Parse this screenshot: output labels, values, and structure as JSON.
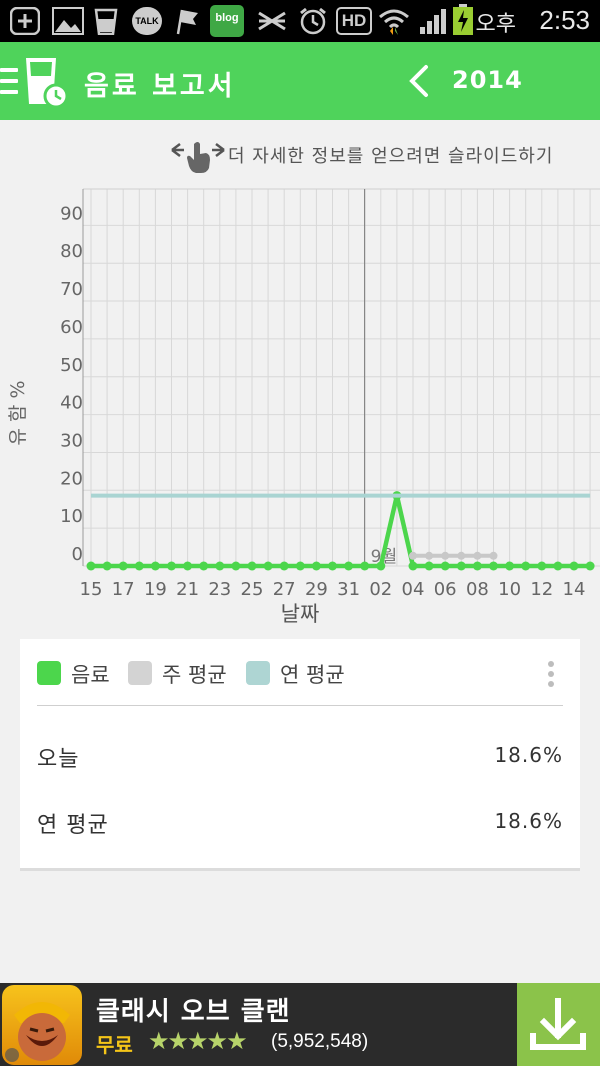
{
  "status_bar": {
    "icons": [
      "add-icon",
      "gallery-icon",
      "cup-icon",
      "kakaotalk-icon",
      "flag-icon",
      "blog-icon",
      "signal-off-icon",
      "alarm-icon",
      "hd-icon",
      "wifi-icon",
      "cell-signal-icon",
      "battery-charging-icon"
    ],
    "kakao_label": "TALK",
    "blog_label": "blog",
    "hd_label": "HD",
    "ampm": "오후",
    "time": "2:53"
  },
  "appbar": {
    "title": "음료 보고서",
    "year": "2014",
    "colors": {
      "primary": "#4fd35b"
    }
  },
  "hint": {
    "text": "더 자세한 정보를 얻으려면 슬라이드하기"
  },
  "chart_data": {
    "type": "line",
    "ylabel": "유 함 %",
    "xlabel": "날짜",
    "ylim": [
      0,
      100
    ],
    "yticks": [
      0,
      10,
      20,
      30,
      40,
      50,
      60,
      70,
      80,
      90
    ],
    "x_tick_labels": [
      "15",
      "17",
      "19",
      "21",
      "23",
      "25",
      "27",
      "29",
      "31",
      "02",
      "04",
      "06",
      "08",
      "10",
      "12",
      "14"
    ],
    "month_marker": "9월",
    "x": [
      "08-15",
      "08-16",
      "08-17",
      "08-18",
      "08-19",
      "08-20",
      "08-21",
      "08-22",
      "08-23",
      "08-24",
      "08-25",
      "08-26",
      "08-27",
      "08-28",
      "08-29",
      "08-30",
      "08-31",
      "09-01",
      "09-02",
      "09-03",
      "09-04",
      "09-05",
      "09-06",
      "09-07",
      "09-08",
      "09-09",
      "09-10",
      "09-11",
      "09-12",
      "09-13",
      "09-14",
      "09-15"
    ],
    "series": [
      {
        "name": "음료",
        "color": "#4cd64c",
        "values": [
          0,
          0,
          0,
          0,
          0,
          0,
          0,
          0,
          0,
          0,
          0,
          0,
          0,
          0,
          0,
          0,
          0,
          0,
          0,
          18.6,
          0,
          0,
          0,
          0,
          0,
          0,
          0,
          0,
          0,
          0,
          0,
          0
        ]
      },
      {
        "name": "주 평균",
        "color": "#c8c8c8",
        "values": [
          null,
          null,
          null,
          null,
          null,
          null,
          null,
          null,
          null,
          null,
          null,
          null,
          null,
          null,
          null,
          null,
          null,
          null,
          null,
          null,
          2.7,
          2.7,
          2.7,
          2.7,
          2.7,
          2.7,
          null,
          null,
          null,
          null,
          null,
          null
        ]
      },
      {
        "name": "연 평균",
        "color": "#a9d4d2",
        "values": [
          18.6,
          18.6,
          18.6,
          18.6,
          18.6,
          18.6,
          18.6,
          18.6,
          18.6,
          18.6,
          18.6,
          18.6,
          18.6,
          18.6,
          18.6,
          18.6,
          18.6,
          18.6,
          18.6,
          18.6,
          18.6,
          18.6,
          18.6,
          18.6,
          18.6,
          18.6,
          18.6,
          18.6,
          18.6,
          18.6,
          18.6,
          18.6
        ]
      }
    ]
  },
  "legend": {
    "items": [
      {
        "label": "음료",
        "color": "#4cd64c"
      },
      {
        "label": "주 평균",
        "color": "#d3d3d3"
      },
      {
        "label": "연 평균",
        "color": "#aed5d3"
      }
    ]
  },
  "stats": {
    "today_label": "오늘",
    "today_value": "18.6%",
    "year_avg_label": "연 평균",
    "year_avg_value": "18.6%"
  },
  "ad": {
    "title": "클래시 오브 클랜",
    "price": "무료",
    "rating": 4.5,
    "stars": "★★★★★",
    "review_count": "(5,952,548)"
  }
}
